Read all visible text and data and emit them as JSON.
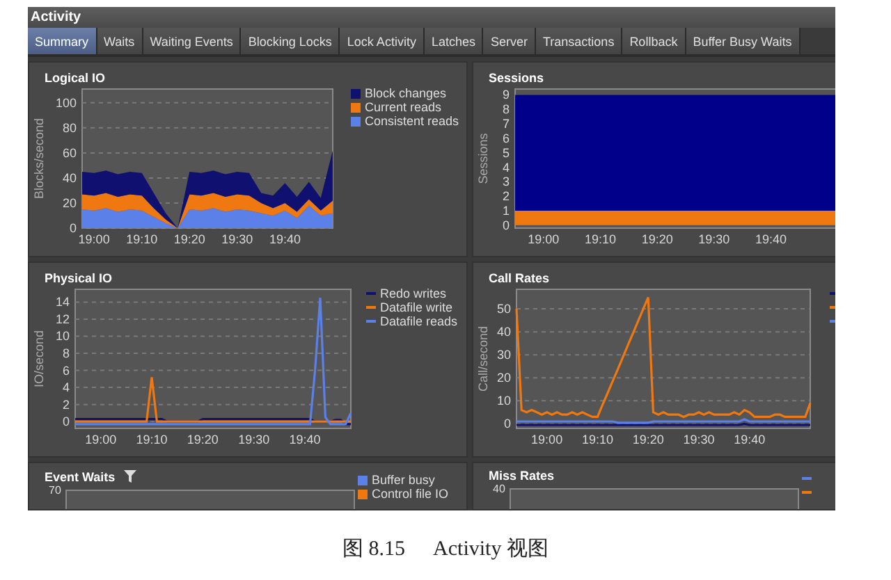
{
  "window": {
    "title": "Activity"
  },
  "tabs": [
    {
      "label": "Summary",
      "selected": true
    },
    {
      "label": "Waits",
      "selected": false
    },
    {
      "label": "Waiting Events",
      "selected": false
    },
    {
      "label": "Blocking Locks",
      "selected": false
    },
    {
      "label": "Lock Activity",
      "selected": false
    },
    {
      "label": "Latches",
      "selected": false
    },
    {
      "label": "Server",
      "selected": false
    },
    {
      "label": "Transactions",
      "selected": false
    },
    {
      "label": "Rollback",
      "selected": false
    },
    {
      "label": "Buffer Busy Waits",
      "selected": false
    }
  ],
  "panels": [
    {
      "kind": "chart",
      "title": "Logical IO",
      "chart_data": {
        "type": "area",
        "grid": true,
        "stacked": true,
        "ylabel": "Blocks/second",
        "categories": [
          null,
          "19:00",
          null,
          null,
          null,
          "19:10",
          null,
          null,
          null,
          "19:20",
          null,
          null,
          null,
          "19:30",
          null,
          null,
          null,
          "19:40",
          null,
          null,
          null,
          null
        ],
        "ylim": [
          0,
          111
        ],
        "yticks": [
          0,
          20,
          40,
          60,
          80,
          100
        ],
        "series": [
          {
            "name": "Block changes",
            "color": "#101070",
            "values": [
              18,
              18,
              18,
              18,
              18,
              18,
              12,
              5,
              0,
              18,
              18,
              18,
              18,
              18,
              18,
              8,
              10,
              16,
              12,
              14,
              10,
              40
            ]
          },
          {
            "name": "Current reads",
            "color": "#f07810",
            "values": [
              12,
              12,
              12,
              12,
              12,
              12,
              7,
              3,
              0,
              12,
              12,
              12,
              12,
              12,
              12,
              8,
              6,
              6,
              5,
              5,
              4,
              10
            ]
          },
          {
            "name": "Consistent reads",
            "color": "#5b80e8",
            "values": [
              15,
              14,
              16,
              13,
              15,
              14,
              9,
              4,
              0,
              15,
              14,
              16,
              13,
              15,
              14,
              12,
              10,
              14,
              8,
              18,
              10,
              12
            ]
          }
        ]
      }
    },
    {
      "kind": "chart",
      "title": "Sessions",
      "chart_data": {
        "type": "area",
        "stacked": true,
        "ylabel": "Sessions",
        "categories": [
          null,
          "19:00",
          null,
          "19:10",
          null,
          "19:20",
          null,
          "19:30",
          null,
          "19:40",
          null,
          null,
          null
        ],
        "ylim": [
          -0.2,
          9.4
        ],
        "yticks": [
          0,
          1,
          2,
          3,
          4,
          5,
          6,
          7,
          8,
          9
        ],
        "series": [
          {
            "color": "#00008b",
            "values": [
              8,
              8,
              8,
              8,
              8,
              8,
              8,
              8,
              8,
              8,
              8,
              8,
              8
            ]
          },
          {
            "color": "#f07810",
            "values": [
              1,
              1,
              1,
              1,
              1,
              1,
              1,
              1,
              1,
              1,
              1,
              1,
              1
            ]
          }
        ]
      }
    },
    {
      "kind": "chart",
      "title": "Physical IO",
      "chart_data": {
        "type": "line",
        "grid": true,
        "ylabel": "IO/second",
        "categories": [
          null,
          null,
          null,
          null,
          null,
          "19:00",
          null,
          null,
          null,
          null,
          null,
          null,
          null,
          null,
          null,
          "19:10",
          null,
          null,
          null,
          null,
          null,
          null,
          null,
          null,
          null,
          "19:20",
          null,
          null,
          null,
          null,
          null,
          null,
          null,
          null,
          null,
          "19:30",
          null,
          null,
          null,
          null,
          null,
          null,
          null,
          null,
          null,
          "19:40",
          null,
          null,
          null,
          null,
          null,
          null,
          null,
          null,
          null
        ],
        "ylim": [
          -0.8,
          15.5
        ],
        "yticks": [
          0,
          2,
          4,
          6,
          8,
          10,
          12,
          14
        ],
        "series": [
          {
            "name": "Redo writes",
            "color": "#101070",
            "values": [
              0.3,
              0.3,
              0.3,
              0.3,
              0.3,
              0.3,
              0.3,
              0.3,
              0.3,
              0.3,
              0.3,
              0.3,
              0.3,
              0.3,
              0.3,
              0.3,
              0.3,
              0.3,
              0,
              0,
              0,
              0,
              0,
              0,
              0,
              0.3,
              0.3,
              0.3,
              0.3,
              0.3,
              0.3,
              0.3,
              0.3,
              0.3,
              0.3,
              0.3,
              0.3,
              0.3,
              0.3,
              0.3,
              0.3,
              0.3,
              0.3,
              0.3,
              0.3,
              0.3,
              0.3,
              0,
              0,
              0,
              0,
              0.2,
              0.2,
              -0.3,
              -0.3
            ]
          },
          {
            "name": "Datafile write",
            "color": "#f07810",
            "values": [
              0,
              0,
              0,
              0,
              0,
              0,
              0,
              0,
              0,
              0,
              0,
              0,
              0,
              0,
              0,
              5.2,
              0,
              0,
              0,
              0,
              0,
              0,
              0,
              0,
              0,
              0,
              0,
              0,
              0,
              0,
              0,
              0,
              0,
              0,
              0,
              0,
              0,
              0,
              0,
              0,
              0,
              0,
              0,
              0,
              0,
              0,
              0,
              0,
              0,
              0,
              0,
              0,
              0,
              0,
              0
            ]
          },
          {
            "name": "Datafile reads",
            "color": "#5b80e8",
            "values": [
              -0.3,
              -0.3,
              -0.3,
              -0.3,
              -0.3,
              -0.3,
              -0.3,
              -0.3,
              -0.3,
              -0.3,
              -0.3,
              -0.3,
              -0.3,
              -0.3,
              -0.3,
              -0.3,
              -0.3,
              -0.3,
              -0.3,
              -0.3,
              -0.3,
              -0.3,
              -0.3,
              -0.3,
              -0.3,
              -0.3,
              -0.3,
              -0.3,
              -0.3,
              -0.3,
              -0.3,
              -0.3,
              -0.3,
              -0.3,
              -0.3,
              -0.3,
              -0.3,
              -0.3,
              -0.3,
              -0.3,
              -0.3,
              -0.3,
              -0.3,
              -0.3,
              -0.3,
              -0.3,
              -0.3,
              6,
              14.5,
              0.5,
              -0.3,
              -0.3,
              -0.3,
              -0.3,
              1
            ]
          }
        ]
      }
    },
    {
      "kind": "chart",
      "title": "Call Rates",
      "chart_data": {
        "type": "line",
        "grid": true,
        "ylabel": "Call/second",
        "categories": [
          null,
          null,
          null,
          null,
          null,
          null,
          "19:00",
          null,
          null,
          null,
          null,
          null,
          null,
          null,
          null,
          null,
          "19:10",
          null,
          null,
          null,
          null,
          null,
          null,
          null,
          null,
          null,
          "19:20",
          null,
          null,
          null,
          null,
          null,
          null,
          null,
          null,
          null,
          "19:30",
          null,
          null,
          null,
          null,
          null,
          null,
          null,
          null,
          null,
          "19:40",
          null,
          null,
          null,
          null,
          null,
          null,
          null,
          null,
          null,
          null,
          null,
          null
        ],
        "ylim": [
          -2,
          58.5
        ],
        "yticks": [
          0,
          10,
          20,
          30,
          40,
          50
        ],
        "series": [
          {
            "color": "#101070",
            "values": [
              -0.5,
              -0.5,
              -0.5,
              -0.5,
              -0.5,
              -0.5,
              -0.5,
              -0.5,
              -0.5,
              -0.5,
              -0.5,
              -0.5,
              -0.5,
              -0.5,
              -0.5,
              -0.5,
              -0.5,
              -0.5,
              -0.5,
              -0.5,
              -0.5,
              -0.5,
              -0.5,
              -0.5,
              -0.5,
              -0.5,
              -0.5,
              -0.5,
              -0.5,
              -0.5,
              -0.5,
              -0.5,
              -0.5,
              -0.5,
              -0.5,
              -0.5,
              -0.5,
              -0.5,
              -0.5,
              -0.5,
              -0.5,
              -0.5,
              -0.5,
              -0.5,
              -0.5,
              0,
              -0.5,
              -0.5,
              -0.5,
              -0.5,
              -0.5,
              -0.5,
              -0.5,
              -0.5,
              -0.5,
              -0.5,
              -0.5,
              -0.5,
              -0.5
            ]
          },
          {
            "color": "#f07810",
            "values": [
              50,
              6,
              5,
              6,
              5,
              4,
              5,
              4,
              5,
              4,
              4,
              5,
              4,
              5,
              4,
              3,
              3,
              8.2,
              13.4,
              18.6,
              23.8,
              29,
              34.2,
              39.4,
              44.6,
              49.8,
              55,
              5,
              4,
              5,
              4,
              4,
              4,
              3,
              4,
              4,
              5,
              4,
              5,
              4,
              4,
              4,
              4,
              5,
              4,
              6,
              5,
              3,
              3,
              3,
              3,
              4,
              4,
              3,
              3,
              3,
              3,
              3,
              9
            ]
          },
          {
            "color": "#5b80e8",
            "values": [
              1,
              1,
              1,
              1,
              1,
              1,
              1,
              1,
              1,
              1,
              1,
              1,
              1,
              1,
              1,
              1,
              1,
              1,
              1,
              1,
              0.5,
              0.5,
              0.5,
              0.5,
              0.5,
              0.5,
              0.5,
              1,
              1,
              1,
              1,
              1,
              1,
              1,
              1,
              1,
              1,
              1,
              1,
              1,
              1,
              1,
              1,
              1,
              1,
              2,
              1,
              1,
              1,
              1,
              1,
              1,
              1,
              1,
              1,
              1,
              1,
              1,
              1
            ]
          }
        ]
      }
    },
    {
      "kind": "partial",
      "title": "Event Waits",
      "filter_icon": true,
      "y_tick": "70",
      "legend": [
        {
          "label": "Buffer busy",
          "color": "#5b80e8"
        },
        {
          "label": "Control file IO",
          "color": "#f07810"
        }
      ]
    },
    {
      "kind": "partial",
      "title": "Miss Rates",
      "filter_icon": false,
      "y_tick": "40",
      "legend": [
        {
          "color": "#5b80e8"
        },
        {
          "color": "#f07810"
        }
      ]
    }
  ],
  "caption": {
    "figure_number": "图 8.15",
    "text": "Activity 视图"
  }
}
